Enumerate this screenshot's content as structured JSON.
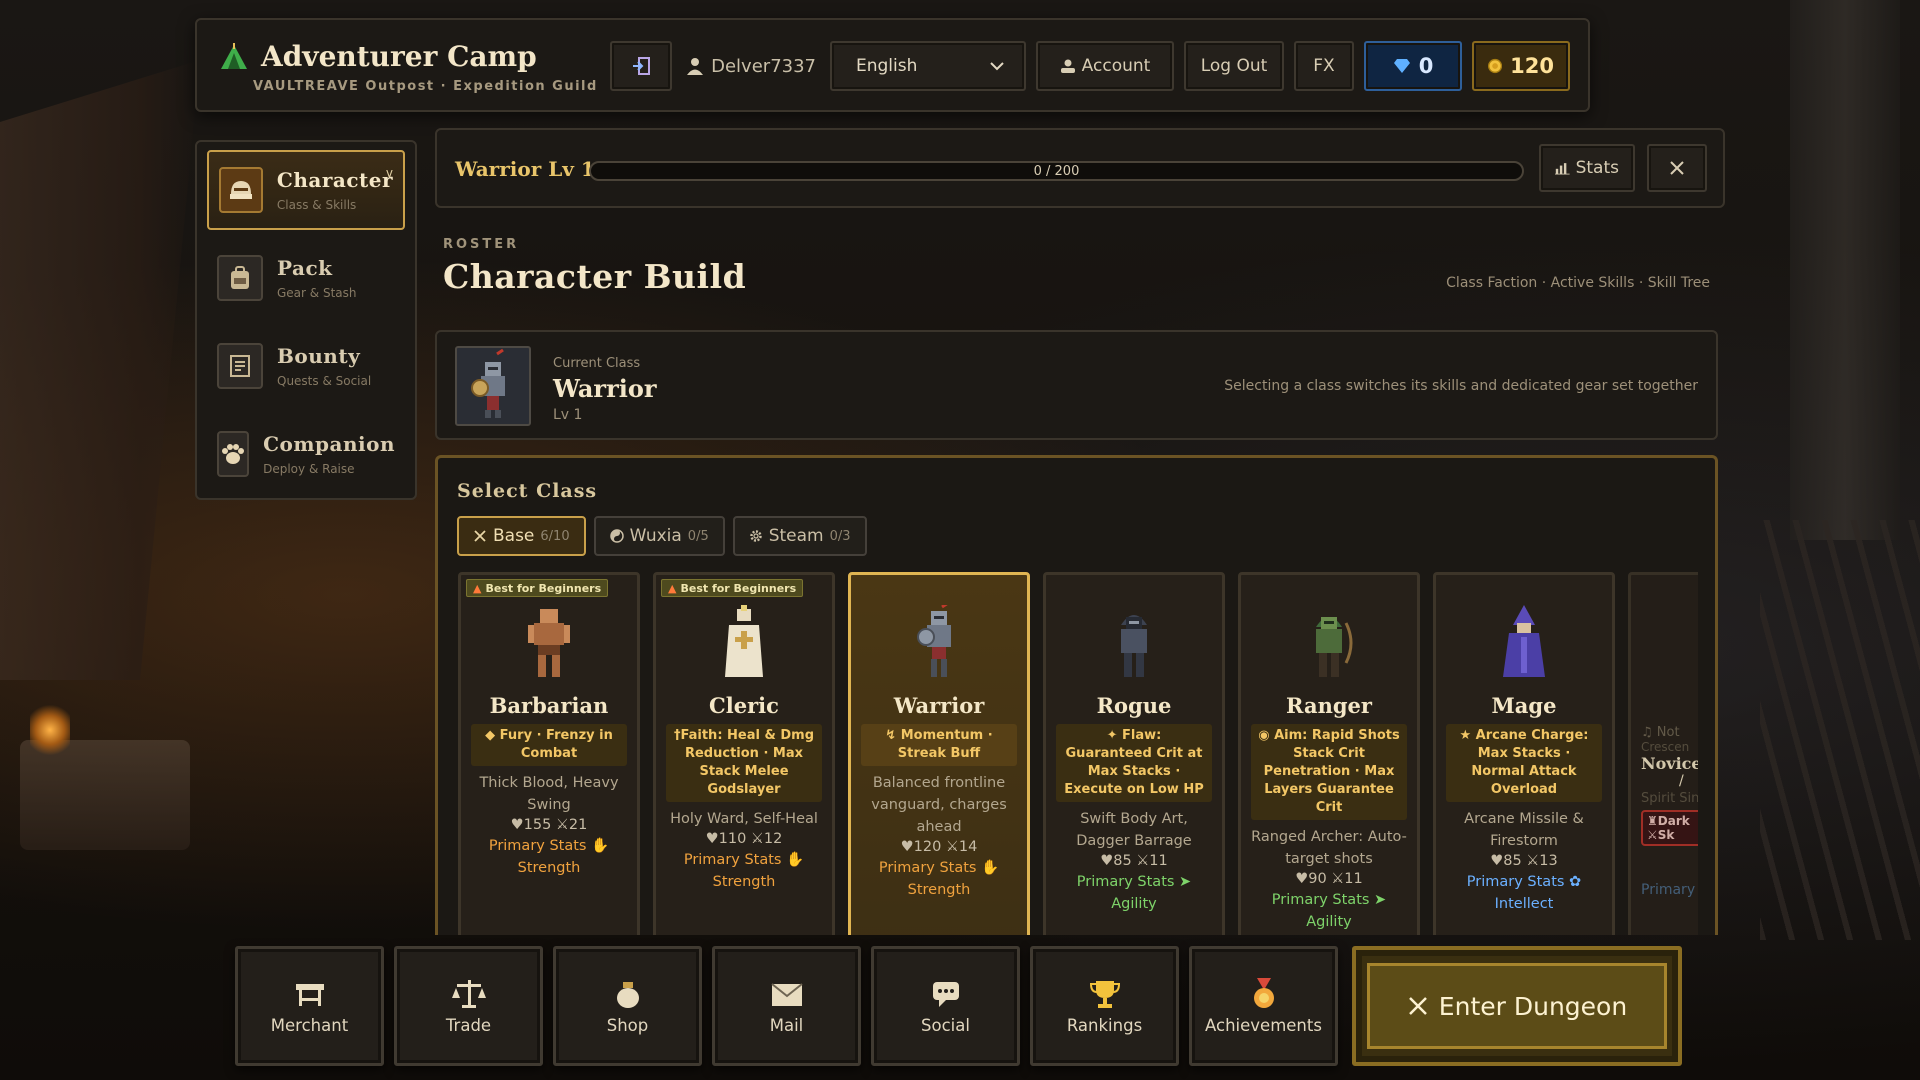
{
  "header": {
    "title": "Adventurer Camp",
    "subtitle": "VAULTREAVE Outpost · Expedition Guild",
    "username": "Delver7337",
    "language": "English",
    "account_label": "Account",
    "logout_label": "Log Out",
    "fx_label": "FX",
    "gems": "0",
    "gold": "120",
    "colors": {
      "gem": "#2e5f9a",
      "gold": "#8a6a1d"
    }
  },
  "sidebar": {
    "items": [
      {
        "label": "Character",
        "sub": "Class & Skills",
        "chevron": "v",
        "icon": "helmet-icon",
        "active": true
      },
      {
        "label": "Pack",
        "sub": "Gear & Stash",
        "icon": "backpack-icon"
      },
      {
        "label": "Bounty",
        "sub": "Quests & Social",
        "icon": "scroll-icon"
      },
      {
        "label": "Companion",
        "sub": "Deploy & Raise",
        "icon": "paw-icon"
      }
    ]
  },
  "level": {
    "title": "Warrior Lv 1",
    "xp_text": "0 / 200",
    "progress": 0,
    "stats_label": "Stats"
  },
  "roster": {
    "kicker": "ROSTER",
    "title": "Character Build",
    "links": "Class Faction · Active Skills · Skill Tree"
  },
  "current": {
    "label": "Current Class",
    "name": "Warrior",
    "level": "Lv 1",
    "note": "Selecting a class switches its skills and dedicated gear set together"
  },
  "select": {
    "title": "Select Class",
    "tabs": [
      {
        "label": "Base",
        "count": "6/10",
        "icon": "swords-icon",
        "active": true
      },
      {
        "label": "Wuxia",
        "count": "0/5",
        "icon": "yin-yang-icon"
      },
      {
        "label": "Steam",
        "count": "0/3",
        "icon": "cog-icon"
      }
    ],
    "classes": [
      {
        "name": "Barbarian",
        "badge": "Best for Beginners",
        "trait": "Fury · Frenzy in Combat",
        "desc": "Thick Blood, Heavy Swing",
        "hp": "155",
        "atk": "21",
        "primary": "Primary Stats",
        "stat": "Strength"
      },
      {
        "name": "Cleric",
        "badge": "Best for Beginners",
        "trait": "†Faith: Heal & Dmg Reduction · Max Stack Melee Godslayer",
        "desc": "Holy Ward, Self-Heal",
        "hp": "110",
        "atk": "12",
        "primary": "Primary Stats",
        "stat": "Strength"
      },
      {
        "name": "Warrior",
        "trait": "Momentum · Streak Buff",
        "desc": "Balanced frontline vanguard, charges ahead",
        "hp": "120",
        "atk": "14",
        "primary": "Primary Stats",
        "stat": "Strength",
        "selected": true
      },
      {
        "name": "Rogue",
        "trait": "Flaw: Guaranteed Crit at Max Stacks · Execute on Low HP",
        "desc": "Swift Body Art, Dagger Barrage",
        "hp": "85",
        "atk": "11",
        "primary": "Primary Stats",
        "stat": "Agility"
      },
      {
        "name": "Ranger",
        "trait": "Aim: Rapid Shots Stack Crit Penetration · Max Layers Guarantee Crit",
        "desc": "Ranged Archer: Auto-target shots",
        "hp": "90",
        "atk": "11",
        "primary": "Primary Stats",
        "stat": "Agility"
      },
      {
        "name": "Mage",
        "trait": "Arcane Charge: Max Stacks · Normal Attack Overload",
        "desc": "Arcane Missile & Firestorm",
        "hp": "85",
        "atk": "13",
        "primary": "Primary Stats",
        "stat": "Intellect"
      },
      {
        "name": "NoviceT",
        "trait": "Not",
        "desc": "Crescen",
        "tag": "Spirit Sin",
        "badge2": "Dark",
        "badge3": "Sk",
        "primary": "Primary"
      }
    ]
  },
  "dock": {
    "items": [
      {
        "label": "Merchant",
        "icon": "stall-icon"
      },
      {
        "label": "Trade",
        "icon": "scales-icon"
      },
      {
        "label": "Shop",
        "icon": "bag-icon"
      },
      {
        "label": "Mail",
        "icon": "envelope-icon"
      },
      {
        "label": "Social",
        "icon": "chat-icon"
      },
      {
        "label": "Rankings",
        "icon": "trophy-icon"
      },
      {
        "label": "Achievements",
        "icon": "medal-icon"
      }
    ],
    "enter_label": "Enter Dungeon"
  }
}
